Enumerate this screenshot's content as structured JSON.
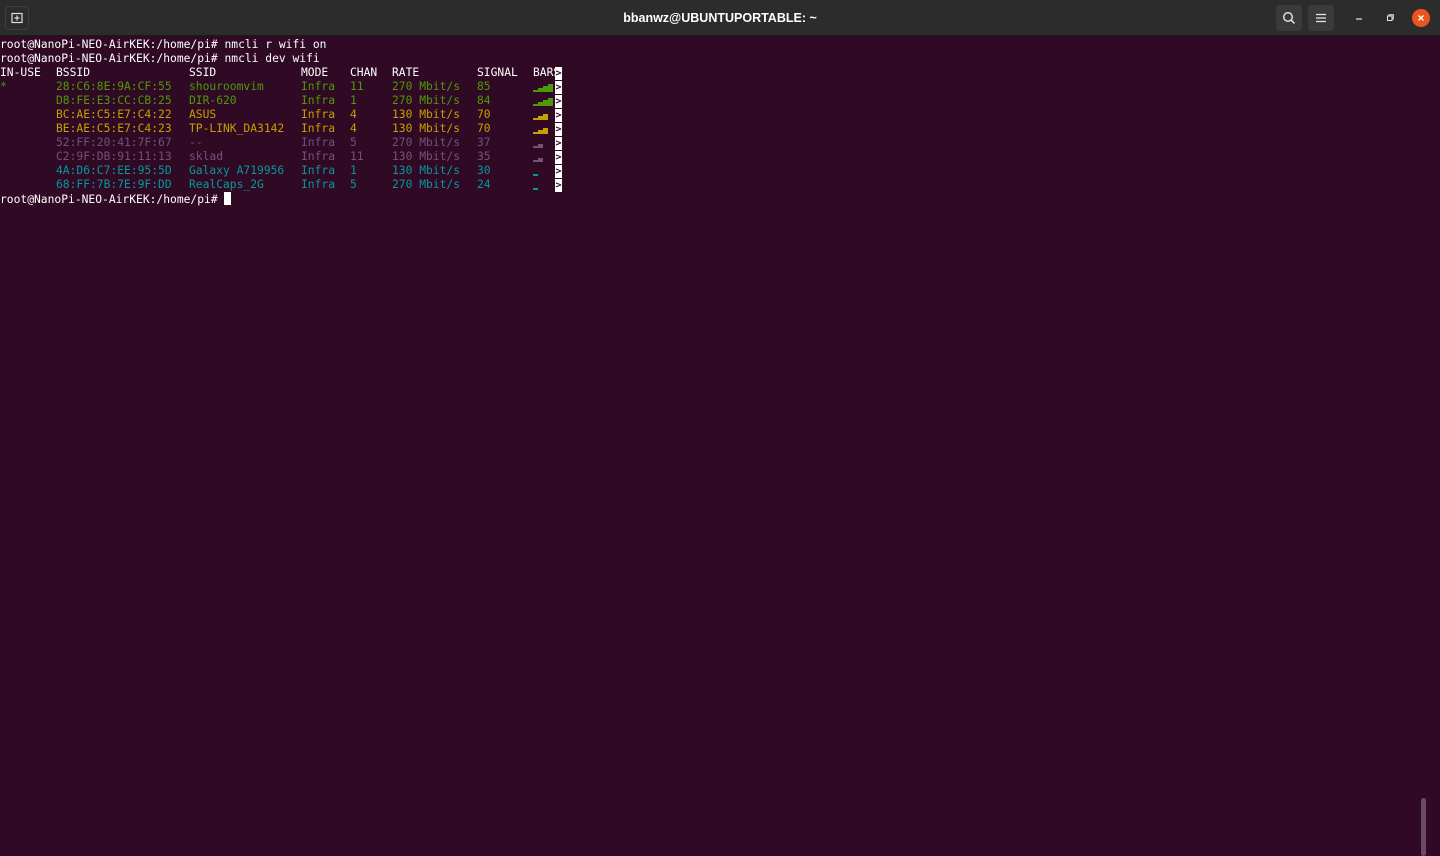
{
  "window": {
    "title": "bbanwz@UBUNTUPORTABLE: ~"
  },
  "toolbar": {
    "new_tab_icon": "new-tab-icon",
    "search_icon": "search-icon",
    "menu_icon": "hamburger-menu-icon",
    "minimize_icon": "minimize-icon",
    "maximize_icon": "maximize-icon",
    "close_icon": "close-icon"
  },
  "terminal": {
    "prompt": "root@NanoPi-NEO-AirKEK:/home/pi#",
    "commands": [
      "nmcli r wifi on",
      "nmcli dev wifi"
    ],
    "headers": [
      "IN-USE",
      "BSSID",
      "SSID",
      "MODE",
      "CHAN",
      "RATE",
      "SIGNAL",
      "BARS"
    ],
    "rows": [
      {
        "in_use": "*",
        "bssid": "28:C6:8E:9A:CF:55",
        "ssid": "shouroomvim",
        "mode": "Infra",
        "chan": "11",
        "rate": "270 Mbit/s",
        "signal": "85",
        "bars": 4,
        "color": "#4e9a06"
      },
      {
        "in_use": "",
        "bssid": "D8:FE:E3:CC:CB:25",
        "ssid": "DIR-620",
        "mode": "Infra",
        "chan": "1",
        "rate": "270 Mbit/s",
        "signal": "84",
        "bars": 4,
        "color": "#4e9a06"
      },
      {
        "in_use": "",
        "bssid": "BC:AE:C5:E7:C4:22",
        "ssid": "ASUS",
        "mode": "Infra",
        "chan": "4",
        "rate": "130 Mbit/s",
        "signal": "70",
        "bars": 3,
        "color": "#c4a000"
      },
      {
        "in_use": "",
        "bssid": "BE:AE:C5:E7:C4:23",
        "ssid": "TP-LINK_DA3142",
        "mode": "Infra",
        "chan": "4",
        "rate": "130 Mbit/s",
        "signal": "70",
        "bars": 3,
        "color": "#c4a000"
      },
      {
        "in_use": "",
        "bssid": "52:FF:20:41:7F:67",
        "ssid": "--",
        "mode": "Infra",
        "chan": "5",
        "rate": "270 Mbit/s",
        "signal": "37",
        "bars": 2,
        "color": "#75507b"
      },
      {
        "in_use": "",
        "bssid": "C2:9F:DB:91:11:13",
        "ssid": "sklad",
        "mode": "Infra",
        "chan": "11",
        "rate": "130 Mbit/s",
        "signal": "35",
        "bars": 2,
        "color": "#75507b"
      },
      {
        "in_use": "",
        "bssid": "4A:D6:C7:EE:95:5D",
        "ssid": "Galaxy A719956",
        "mode": "Infra",
        "chan": "1",
        "rate": "130 Mbit/s",
        "signal": "30",
        "bars": 1,
        "color": "#06989a"
      },
      {
        "in_use": "",
        "bssid": "68:FF:7B:7E:9F:DD",
        "ssid": "RealCaps_2G",
        "mode": "Infra",
        "chan": "5",
        "rate": "270 Mbit/s",
        "signal": "24",
        "bars": 1,
        "color": "#06989a"
      }
    ],
    "truncation_marker": ">"
  }
}
